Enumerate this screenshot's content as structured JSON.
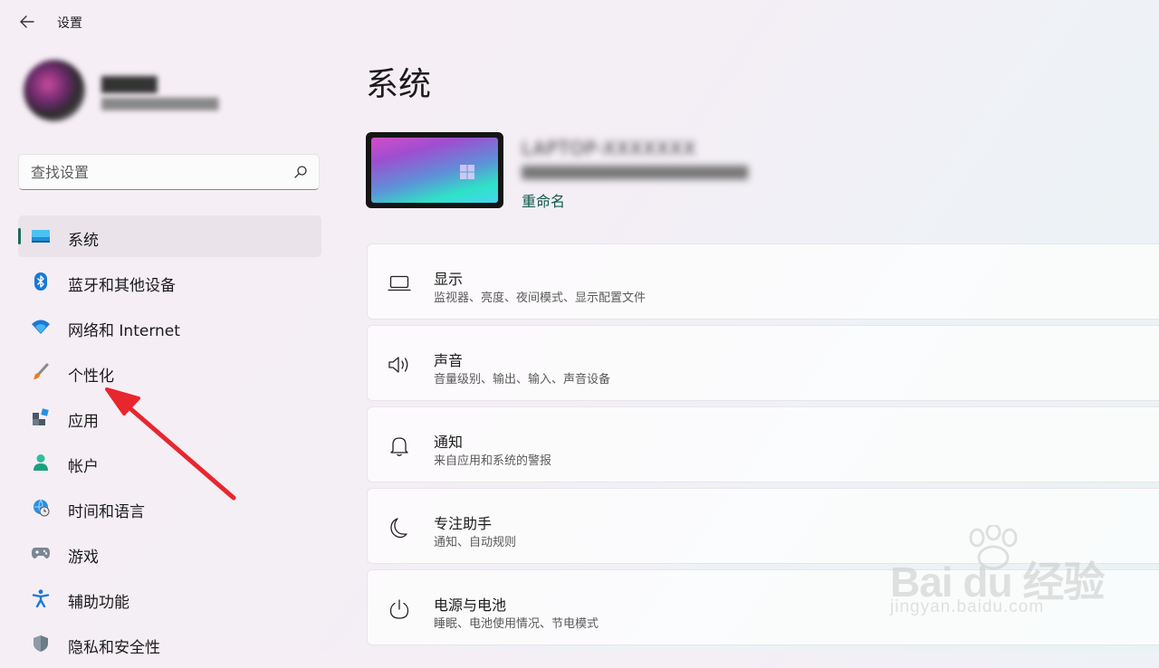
{
  "window": {
    "title": "设置"
  },
  "profile": {
    "name": "█████",
    "email": "██████████████"
  },
  "search": {
    "placeholder": "查找设置"
  },
  "sidebar": {
    "items": [
      {
        "label": "系统",
        "icon": "monitor-icon",
        "active": true
      },
      {
        "label": "蓝牙和其他设备",
        "icon": "bluetooth-icon"
      },
      {
        "label": "网络和 Internet",
        "icon": "wifi-icon"
      },
      {
        "label": "个性化",
        "icon": "paintbrush-icon"
      },
      {
        "label": "应用",
        "icon": "apps-icon"
      },
      {
        "label": "帐户",
        "icon": "person-icon"
      },
      {
        "label": "时间和语言",
        "icon": "globe-clock-icon"
      },
      {
        "label": "游戏",
        "icon": "gamepad-icon"
      },
      {
        "label": "辅助功能",
        "icon": "accessibility-icon"
      },
      {
        "label": "隐私和安全性",
        "icon": "shield-icon"
      }
    ]
  },
  "main": {
    "title": "系统",
    "device": {
      "name": "LAPTOP-XXXXXXX",
      "model": "█████████████████████████",
      "rename_label": "重命名"
    },
    "cards": [
      {
        "title": "显示",
        "subtitle": "监视器、亮度、夜间模式、显示配置文件",
        "icon": "laptop-icon"
      },
      {
        "title": "声音",
        "subtitle": "音量级别、输出、输入、声音设备",
        "icon": "speaker-icon"
      },
      {
        "title": "通知",
        "subtitle": "来自应用和系统的警报",
        "icon": "bell-icon"
      },
      {
        "title": "专注助手",
        "subtitle": "通知、自动规则",
        "icon": "moon-icon"
      },
      {
        "title": "电源与电池",
        "subtitle": "睡眠、电池使用情况、节电模式",
        "icon": "power-icon"
      }
    ]
  },
  "watermark": {
    "text": "Bai du 经验",
    "url": "jingyan.baidu.com"
  },
  "colors": {
    "accent": "#1a6b5a",
    "annotation_arrow": "#e8262f"
  }
}
